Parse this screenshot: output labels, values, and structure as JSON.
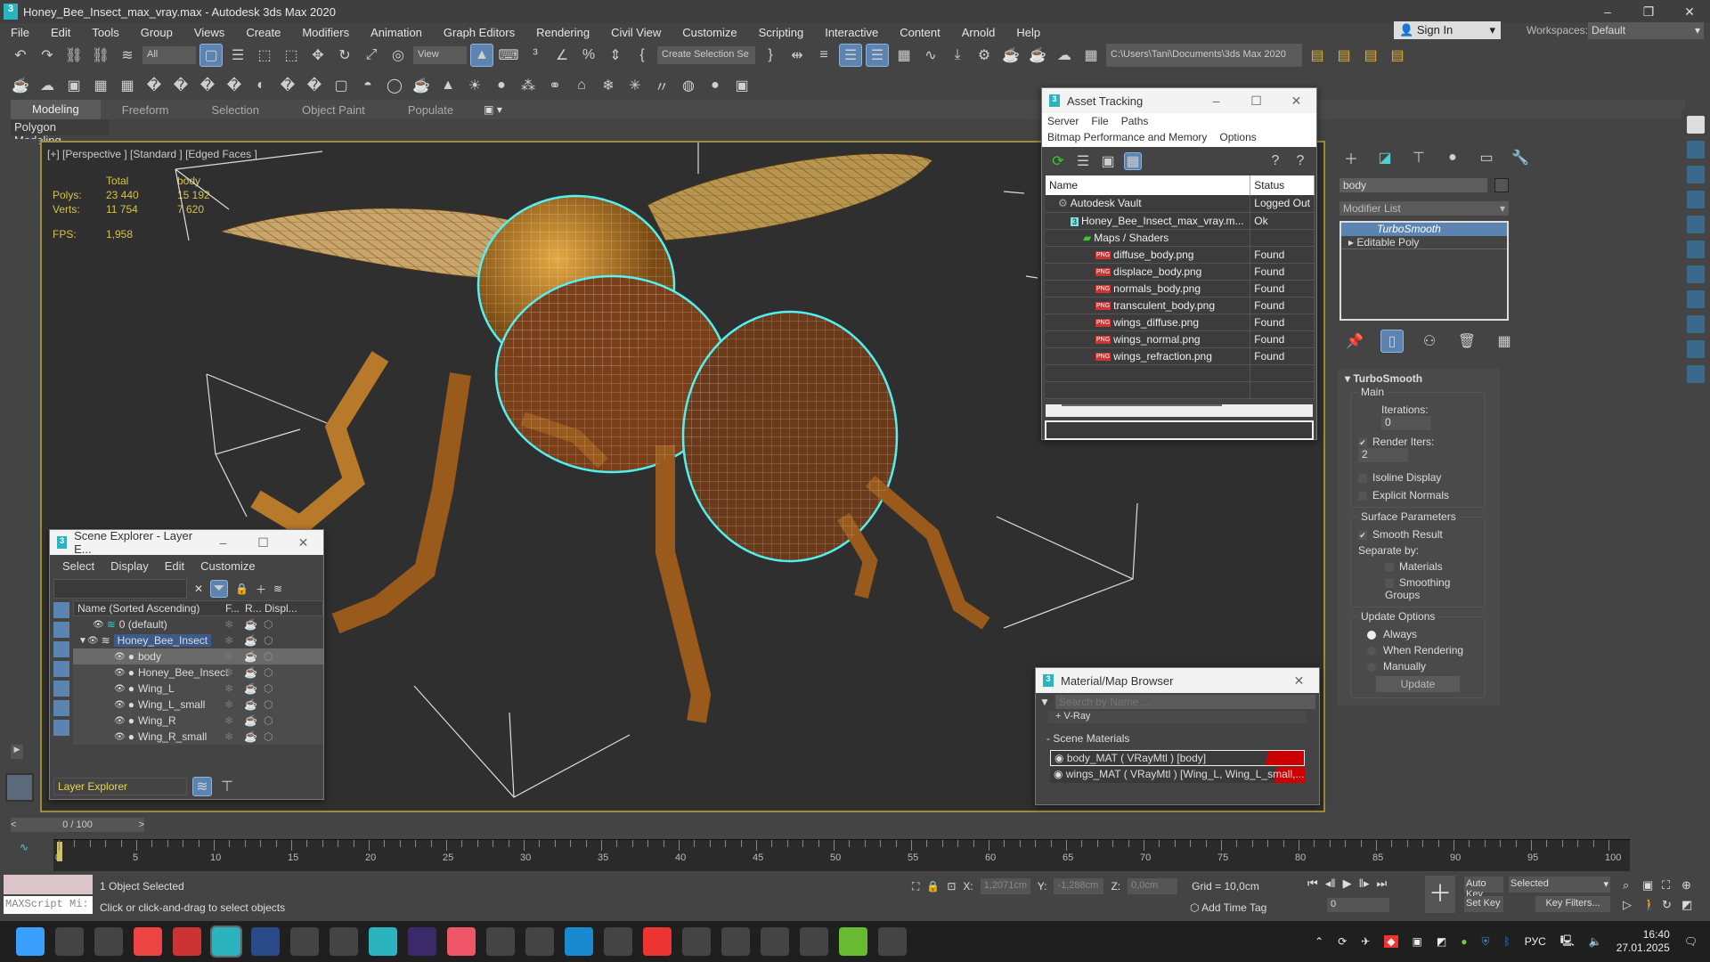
{
  "window": {
    "title": "Honey_Bee_Insect_max_vray.max - Autodesk 3ds Max 2020",
    "logo": "3",
    "controls": [
      "–",
      "❐",
      "✕"
    ]
  },
  "menu": [
    "File",
    "Edit",
    "Tools",
    "Group",
    "Views",
    "Create",
    "Modifiers",
    "Animation",
    "Graph Editors",
    "Rendering",
    "Civil View",
    "Customize",
    "Scripting",
    "Interactive",
    "Content",
    "Arnold",
    "Help"
  ],
  "account": {
    "sign_in": "Sign In",
    "workspaces_label": "Workspaces:",
    "workspace": "Default"
  },
  "toolbar1": {
    "selection_filter": "All",
    "ref_coord": "View",
    "named_selection": "Create Selection Se",
    "project_path": "C:\\Users\\Tani\\Documents\\3ds Max 2020",
    "icons": [
      "undo-icon",
      "redo-icon",
      "link-icon",
      "unlink-icon",
      "bind-spacewarp-icon",
      "select-object-icon",
      "select-by-name-icon",
      "rect-region-icon",
      "window-crossing-icon",
      "move-icon",
      "rotate-icon",
      "scale-icon",
      "placement-icon",
      "select-manipulate-icon",
      "keyboard-shortcut-icon",
      "snap-3d-icon",
      "angle-snap-icon",
      "percent-snap-icon",
      "spinner-snap-icon",
      "edit-named-sel-icon",
      "mirror-icon",
      "align-icon",
      "scene-explorer-icon",
      "layer-explorer-icon",
      "ribbon-icon",
      "curve-editor-icon",
      "schematic-icon",
      "material-editor-icon",
      "render-setup-icon",
      "rendered-frame-icon",
      "render-icon",
      "render-cloud-icon",
      "a360-icon"
    ]
  },
  "toolbar2": {
    "icons": [
      "teapot-icon",
      "cloud-icon",
      "viewport-bg-icon",
      "table-icon",
      "grid-icon",
      "light-icon",
      "camera-icon",
      "helper-icon",
      "render-cam-icon",
      "box-icon",
      "sphere-icon",
      "geosphere-icon",
      "basket-icon",
      "cone-icon",
      "sun-icon",
      "ellipse-icon",
      "particles-icon",
      "molecule-icon",
      "mesh-icon",
      "snowflake-icon",
      "grass-icon",
      "hair-icon",
      "fur-icon",
      "sphere2-icon",
      "compositor-icon",
      "vray-icon",
      "frame-buffer-icon",
      "help-icon"
    ]
  },
  "ribbon": {
    "tabs": [
      "Modeling",
      "Freeform",
      "Selection",
      "Object Paint",
      "Populate"
    ],
    "active": "Modeling",
    "panel": "Polygon Modeling"
  },
  "viewport": {
    "label": "[+] [Perspective ] [Standard ] [Edged Faces ]",
    "stats": {
      "col_total": "Total",
      "col_obj": "body",
      "polys_label": "Polys:",
      "polys_total": "23 440",
      "polys_obj": "15 192",
      "verts_label": "Verts:",
      "verts_total": "11 754",
      "verts_obj": "7 620",
      "fps_label": "FPS:",
      "fps": "1,958"
    }
  },
  "asset_tracking": {
    "title": "Asset Tracking",
    "menu1": [
      "Server",
      "File",
      "Paths"
    ],
    "menu2": [
      "Bitmap Performance and Memory",
      "Options"
    ],
    "columns": [
      "Name",
      "Status"
    ],
    "rows": [
      {
        "name": "Autodesk Vault",
        "status": "Logged Out",
        "indent": 1,
        "icon": "vault"
      },
      {
        "name": "Honey_Bee_Insect_max_vray.m...",
        "status": "Ok",
        "indent": 2,
        "icon": "max"
      },
      {
        "name": "Maps / Shaders",
        "status": "",
        "indent": 3,
        "icon": "maps"
      },
      {
        "name": "diffuse_body.png",
        "status": "Found",
        "indent": 4,
        "icon": "png"
      },
      {
        "name": "displace_body.png",
        "status": "Found",
        "indent": 4,
        "icon": "png"
      },
      {
        "name": "normals_body.png",
        "status": "Found",
        "indent": 4,
        "icon": "png"
      },
      {
        "name": "transculent_body.png",
        "status": "Found",
        "indent": 4,
        "icon": "png"
      },
      {
        "name": "wings_diffuse.png",
        "status": "Found",
        "indent": 4,
        "icon": "png"
      },
      {
        "name": "wings_normal.png",
        "status": "Found",
        "indent": 4,
        "icon": "png"
      },
      {
        "name": "wings_refraction.png",
        "status": "Found",
        "indent": 4,
        "icon": "png"
      }
    ]
  },
  "scene_explorer": {
    "title": "Scene Explorer - Layer E...",
    "menu": [
      "Select",
      "Display",
      "Edit",
      "Customize"
    ],
    "columns": [
      "Name (Sorted Ascending)",
      "F...",
      "R...",
      "Displ..."
    ],
    "rows": [
      {
        "name": "0 (default)",
        "level": 0,
        "kind": "layer"
      },
      {
        "name": "Honey_Bee_Insect",
        "level": 0,
        "kind": "layer-selected"
      },
      {
        "name": "body",
        "level": 1,
        "kind": "object-selected"
      },
      {
        "name": "Honey_Bee_Insect",
        "level": 1,
        "kind": "group"
      },
      {
        "name": "Wing_L",
        "level": 1,
        "kind": "object"
      },
      {
        "name": "Wing_L_small",
        "level": 1,
        "kind": "object"
      },
      {
        "name": "Wing_R",
        "level": 1,
        "kind": "object"
      },
      {
        "name": "Wing_R_small",
        "level": 1,
        "kind": "object"
      }
    ],
    "footer": "Layer Explorer"
  },
  "material_browser": {
    "title": "Material/Map Browser",
    "search_placeholder": "Search by Name ...",
    "group_vray": "+ V-Ray",
    "group_scene": "- Scene Materials",
    "materials": [
      "body_MAT ( VRayMtl ) [body]",
      "wings_MAT ( VRayMtl ) [Wing_L, Wing_L_small,..."
    ]
  },
  "command_panel": {
    "object_name": "body",
    "modifier_list": "Modifier List",
    "stack": [
      "TurboSmooth",
      "Editable Poly"
    ],
    "rollout": "TurboSmooth",
    "main": "Main",
    "iterations_label": "Iterations:",
    "iterations": "0",
    "render_iters_label": "Render Iters:",
    "render_iters": "2",
    "render_iters_checked": true,
    "isoline": "Isoline Display",
    "explicit": "Explicit Normals",
    "surface": "Surface Parameters",
    "smooth_result": "Smooth Result",
    "separate_by": "Separate by:",
    "materials": "Materials",
    "smoothing_groups": "Smoothing Groups",
    "update_options": "Update Options",
    "always": "Always",
    "when_rendering": "When Rendering",
    "manually": "Manually",
    "update": "Update"
  },
  "timeline": {
    "frame": "0 / 100",
    "ticks": [
      "0",
      "5",
      "10",
      "15",
      "20",
      "25",
      "30",
      "35",
      "40",
      "45",
      "50",
      "55",
      "60",
      "65",
      "70",
      "75",
      "80",
      "85",
      "90",
      "95",
      "100"
    ]
  },
  "status": {
    "selected": "1 Object Selected",
    "prompt": "Click or click-and-drag to select objects",
    "maxscript": "MAXScript Mi:",
    "x_label": "X:",
    "x": "1,2071cm",
    "y_label": "Y:",
    "y": "-1,288cm",
    "z_label": "Z:",
    "z": "0,0cm",
    "grid": "Grid = 10,0cm",
    "add_time_tag": "Add Time Tag",
    "auto_key": "Auto Key",
    "set_key": "Set Key",
    "key_mode": "Selected",
    "key_filters": "Key Filters...",
    "current_frame": "0"
  },
  "taskbar": {
    "apps": [
      "start-icon",
      "explorer-icon",
      "taskview-icon",
      "chrome-icon",
      "app64-icon",
      "3dsmax-icon",
      "photoshop-icon",
      "app-icon",
      "notepad-icon",
      "3dsmax2-icon",
      "aftereffects-icon",
      "grammarly-icon",
      "search-icon",
      "save-icon",
      "edge-icon",
      "app2-icon",
      "yandex-icon",
      "terminal-icon",
      "telegram-icon",
      "calculator-icon",
      "folder-icon",
      "utorrent-icon",
      "camera-icon"
    ],
    "lang": "РУС",
    "time": "16:40",
    "date": "27.01.2025"
  },
  "colors": {
    "accent": "#5b84b1",
    "selection_cyan": "#4ff0f0",
    "viewport_border": "#a08a3c",
    "stats": "#d5c34a"
  }
}
